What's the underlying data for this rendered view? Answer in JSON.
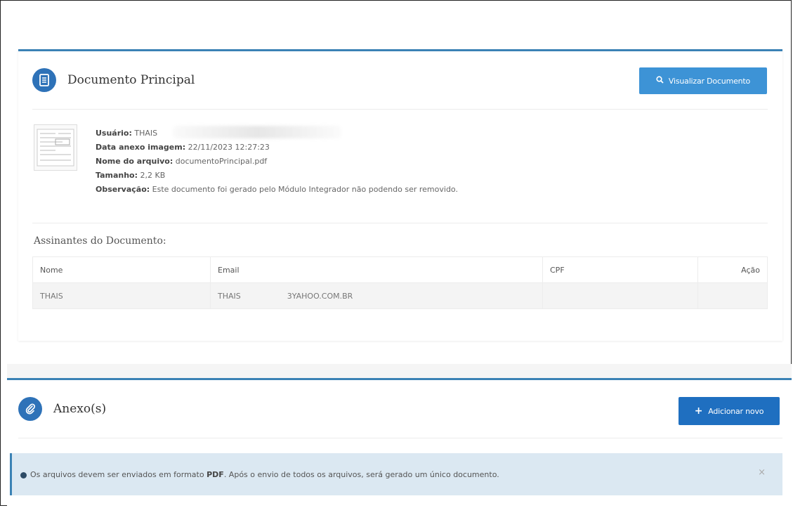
{
  "document_panel": {
    "title": "Documento Principal",
    "view_button_label": "Visualizar Documento",
    "meta": {
      "usuario_label": "Usuário:",
      "usuario_value": "THAIS",
      "data_label": "Data anexo imagem:",
      "data_value": "22/11/2023 12:27:23",
      "nome_label": "Nome do arquivo:",
      "nome_value": "documentoPrincipal.pdf",
      "tamanho_label": "Tamanho:",
      "tamanho_value": "2,2 KB",
      "obs_label": "Observação:",
      "obs_value": "Este documento foi gerado pelo Módulo Integrador não podendo ser removido."
    },
    "signers_title": "Assinantes do Documento:",
    "columns": [
      "Nome",
      "Email",
      "CPF",
      "Ação"
    ],
    "rows": [
      {
        "nome": "THAIS",
        "email_prefix": "THAIS",
        "email_suffix": "3YAHOO.COM.BR",
        "cpf": "",
        "acao": ""
      }
    ]
  },
  "attachments_panel": {
    "title": "Anexo(s)",
    "add_button_label": "Adicionar novo",
    "alert": {
      "text_before": "Os arquivos devem ser enviados em formato",
      "text_bold": "PDF",
      "text_after": ". Após o envio de todos os arquivos, será gerado um único documento.",
      "close": "×"
    }
  },
  "colors": {
    "accent": "#3b82b5",
    "button": "#3d93d6",
    "button_dark": "#1f6fc0",
    "alert_bg": "#dbe8f2"
  },
  "icons": [
    "document-icon",
    "search-icon",
    "paperclip-icon",
    "plus-icon",
    "info-icon",
    "close-icon"
  ]
}
